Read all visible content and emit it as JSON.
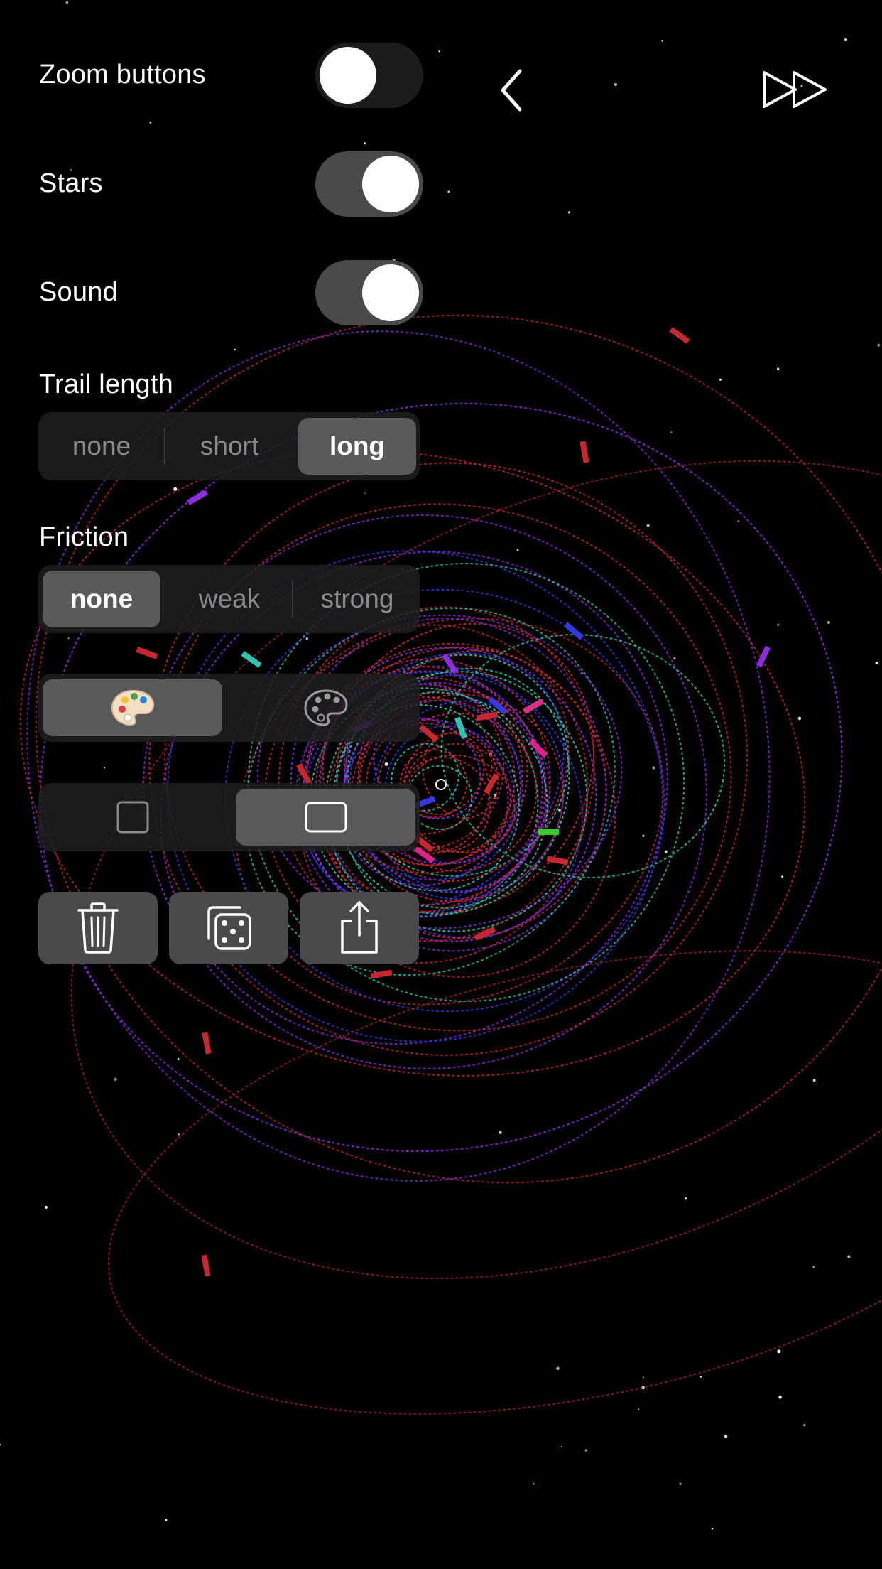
{
  "settings": {
    "zoom_buttons": {
      "label": "Zoom buttons",
      "on": false
    },
    "stars": {
      "label": "Stars",
      "on": true
    },
    "sound": {
      "label": "Sound",
      "on": true
    }
  },
  "trail_length": {
    "label": "Trail length",
    "options": [
      "none",
      "short",
      "long"
    ],
    "selected": "long"
  },
  "friction": {
    "label": "Friction",
    "options": [
      "none",
      "weak",
      "strong"
    ],
    "selected": "none"
  },
  "color_mode": {
    "options": [
      "palette-color-icon",
      "palette-mono-icon"
    ],
    "selected": "palette-color-icon"
  },
  "aspect_mode": {
    "options": [
      "square-icon",
      "rectangle-icon"
    ],
    "selected": "rectangle-icon"
  },
  "actions": [
    "trash-icon",
    "dice-icon",
    "share-icon"
  ],
  "nav": {
    "back": "chevron-left-icon",
    "forward": "fast-forward-icon"
  },
  "colors": {
    "background": "#000000",
    "control_bg": "#1c1c1e",
    "selected_bg": "#59595c",
    "trail_red": "#c62832",
    "trail_purple": "#8e2de0",
    "trail_teal": "#2ec4b0",
    "trail_blue": "#3838e0"
  }
}
